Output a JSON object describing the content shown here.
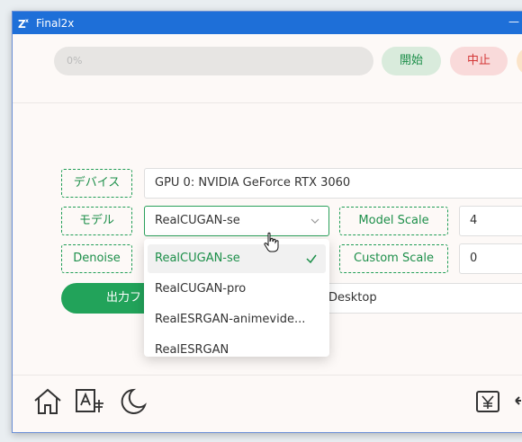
{
  "window": {
    "title": "Final2x",
    "minimize_glyph": "—"
  },
  "toolbar": {
    "progress_text": "0%",
    "progress": 0,
    "start_label": "開始",
    "stop_label": "中止"
  },
  "settings": {
    "device": {
      "label": "デバイス",
      "value": "GPU 0: NVIDIA GeForce RTX 3060"
    },
    "model": {
      "label": "モデル",
      "value": "RealCUGAN-se"
    },
    "model_scale": {
      "label": "Model Scale",
      "value": "4"
    },
    "denoise": {
      "label": "Denoise"
    },
    "custom_scale": {
      "label": "Custom Scale",
      "value": "0"
    },
    "output": {
      "label": "出力フ",
      "path": "Desktop"
    }
  },
  "model_dropdown": {
    "items": [
      {
        "label": "RealCUGAN-se",
        "selected": true
      },
      {
        "label": "RealCUGAN-pro",
        "selected": false
      },
      {
        "label": "RealESRGAN-animevide...",
        "selected": false
      },
      {
        "label": "RealESRGAN",
        "selected": false
      }
    ]
  },
  "bottom_bar": {
    "icons": [
      "home-icon",
      "translate-icon",
      "moon-icon",
      "yen-icon",
      "back-arrow-icon"
    ]
  },
  "colors": {
    "accent": "#22a35a",
    "titlebar": "#1e6fd8",
    "stop": "#d33636"
  }
}
